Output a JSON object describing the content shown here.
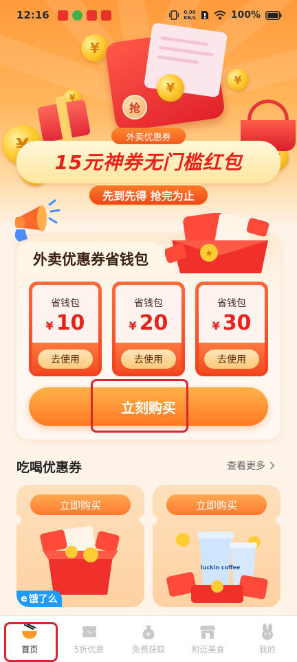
{
  "status_bar": {
    "time": "12:16",
    "net_speed_value": "0.90",
    "net_speed_unit": "KB/s",
    "battery": "100%"
  },
  "hero": {
    "tag": "外卖优惠券",
    "title": "15元神券无门槛红包",
    "subtitle": "先到先得 抢完为止",
    "seal_char": "抢"
  },
  "wallet": {
    "title": "外卖优惠券省钱包",
    "coupons": [
      {
        "label": "省钱包",
        "currency": "¥",
        "amount": "10",
        "button": "去使用"
      },
      {
        "label": "省钱包",
        "currency": "¥",
        "amount": "20",
        "button": "去使用"
      },
      {
        "label": "省钱包",
        "currency": "¥",
        "amount": "30",
        "button": "去使用"
      }
    ],
    "buy_button": "立刻购买"
  },
  "section": {
    "title": "吃喝优惠券",
    "more": "查看更多",
    "more_icon": "chevron-right-icon",
    "cards": [
      {
        "button": "立即购买",
        "logo_text": "饿了么"
      },
      {
        "button": "立即购买",
        "brand_text": "luckin coffee"
      }
    ]
  },
  "bottom_nav": {
    "items": [
      {
        "label": "首页",
        "icon": "bowl-chopsticks-icon",
        "active": true
      },
      {
        "label": "5折优惠",
        "icon": "half-price-ticket-icon",
        "active": false
      },
      {
        "label": "免费获取",
        "icon": "money-bag-icon",
        "active": false
      },
      {
        "label": "附近美食",
        "icon": "storefront-icon",
        "active": false
      },
      {
        "label": "我的",
        "icon": "user-icon",
        "active": false
      }
    ]
  },
  "colors": {
    "accent_orange": "#ff7a22",
    "brand_red": "#e8221a",
    "highlight_red": "#d9252f"
  }
}
